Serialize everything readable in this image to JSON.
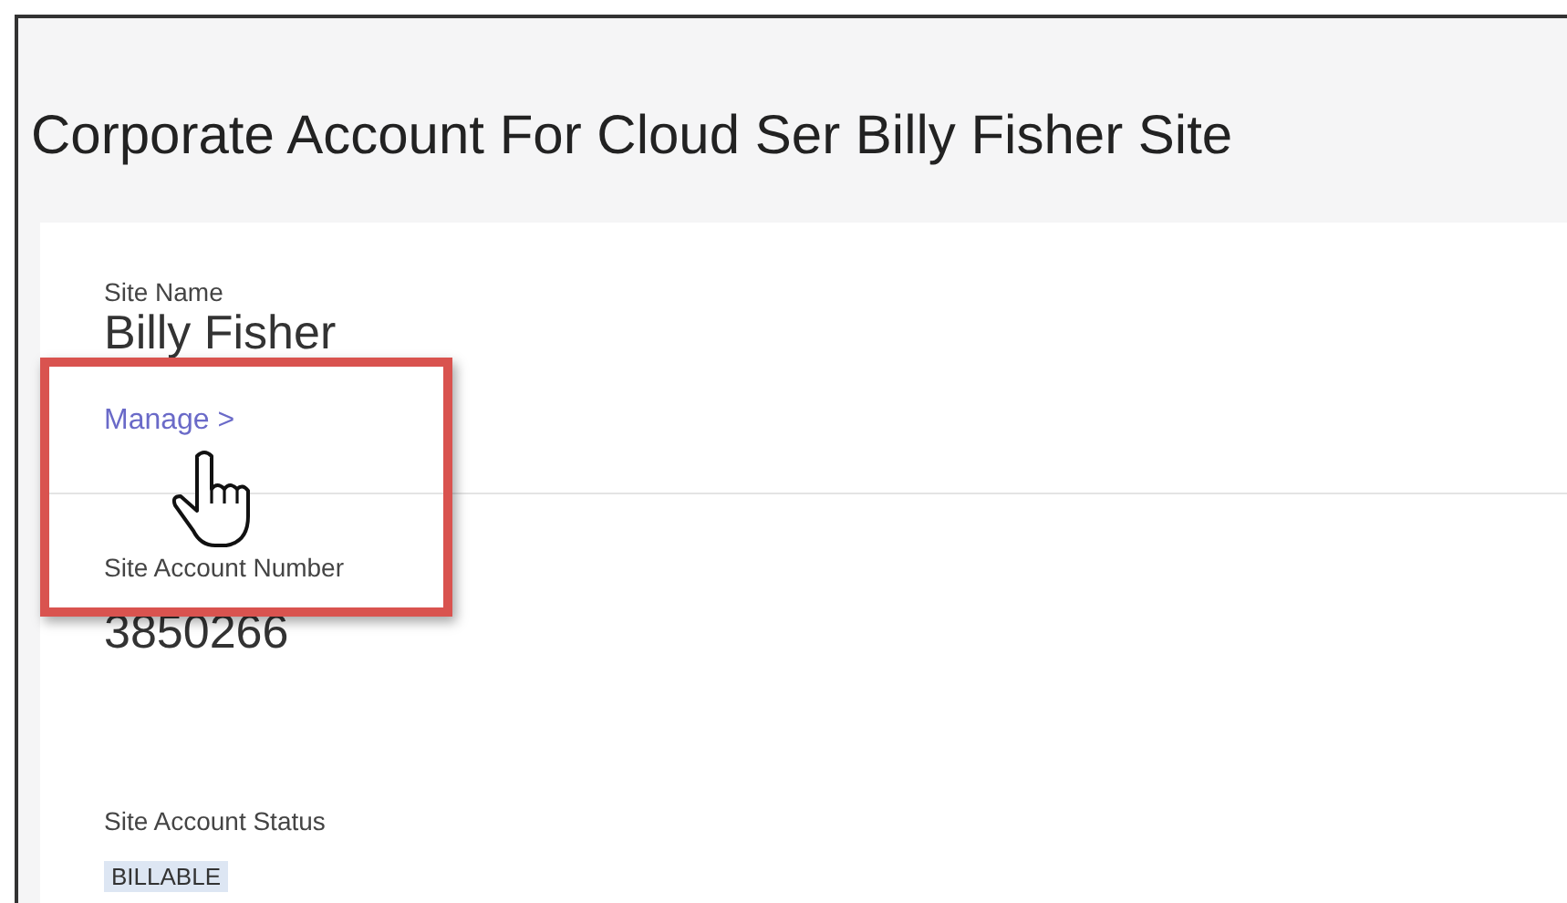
{
  "title": "Corporate Account For Cloud Ser Billy Fisher Site",
  "site_name": {
    "label": "Site Name",
    "value": "Billy Fisher",
    "link": "Manage >"
  },
  "account_number": {
    "label": "Site Account Number",
    "value": "3850266"
  },
  "account_status": {
    "label": "Site Account Status",
    "badge": "BILLABLE"
  }
}
